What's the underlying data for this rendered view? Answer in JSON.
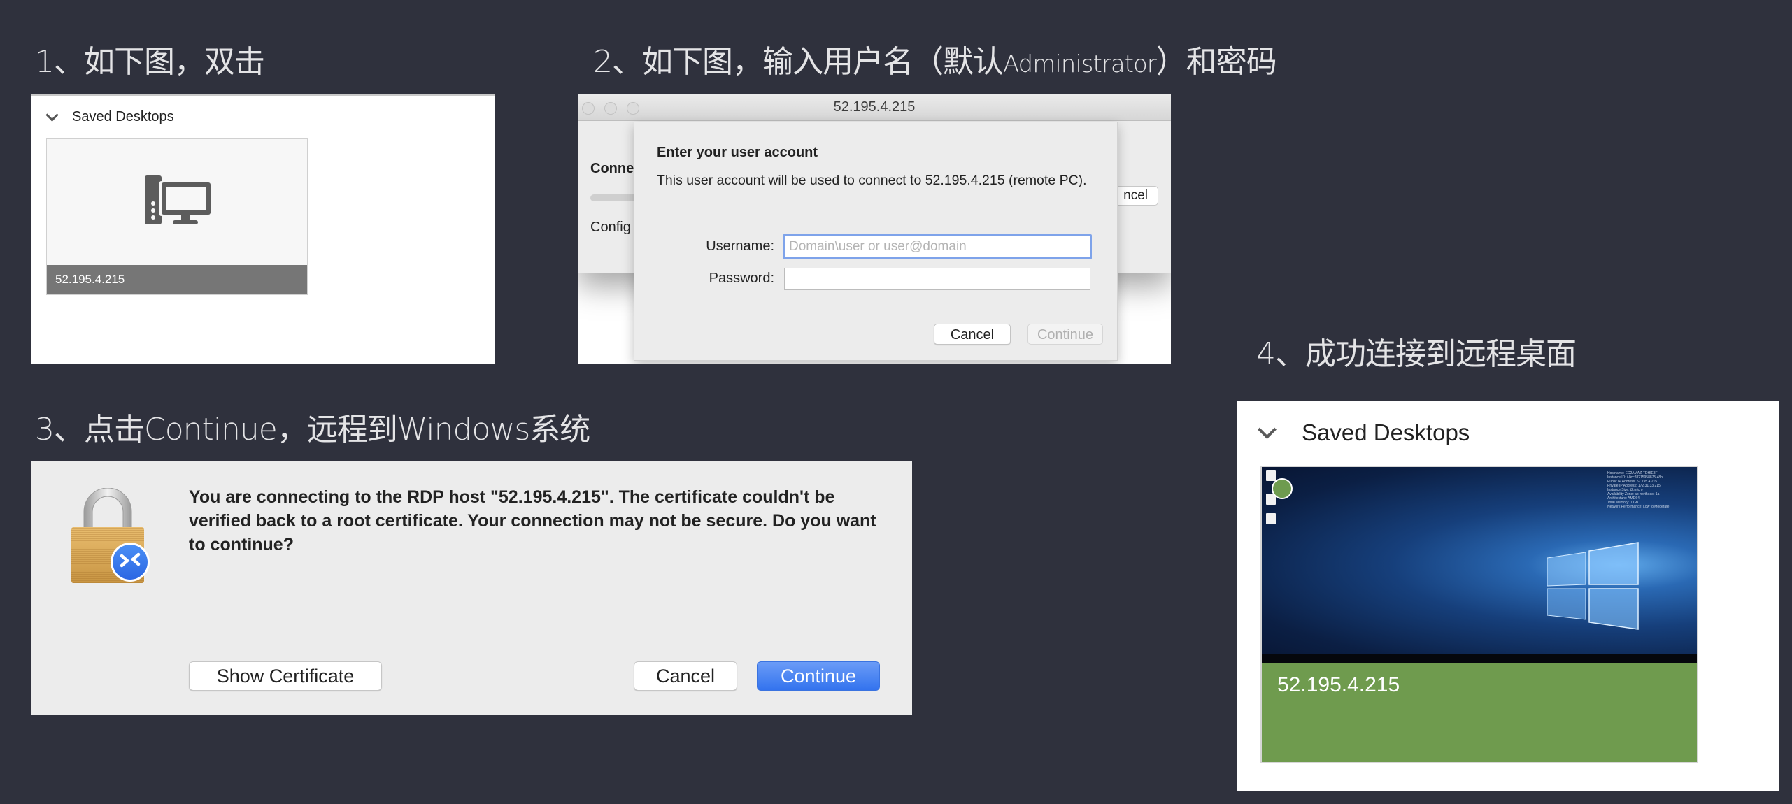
{
  "steps": [
    {
      "title": "1、如下图，双击"
    },
    {
      "title_pre": "2、如下图，输入用户名（默认",
      "title_small": "Administrator",
      "title_post": "）和密码"
    },
    {
      "title": "3、点击Continue，远程到Windows系统"
    },
    {
      "title": "4、成功连接到远程桌面"
    }
  ],
  "panel1": {
    "section_header": "Saved Desktops",
    "tile": {
      "label": "52.195.4.215",
      "icon": "computer-monitor-icon"
    }
  },
  "panel2": {
    "window_title": "52.195.4.215",
    "background": {
      "connecting_label": "Conne",
      "config_label": "Config",
      "cancel_label": "ncel"
    },
    "sheet": {
      "heading": "Enter your user account",
      "description": "This user account will be used to connect to 52.195.4.215 (remote PC).",
      "username_label": "Username:",
      "username_placeholder": "Domain\\user or user@domain",
      "username_value": "",
      "password_label": "Password:",
      "password_value": "",
      "cancel_button": "Cancel",
      "continue_button": "Continue"
    }
  },
  "panel3": {
    "message": "You are connecting to the RDP host \"52.195.4.215\". The certificate couldn't be verified back to a root certificate. Your connection may not be secure. Do you want to continue?",
    "show_certificate_button": "Show Certificate",
    "cancel_button": "Cancel",
    "continue_button": "Continue",
    "icon": "lock-remote-desktop-icon"
  },
  "panel4": {
    "section_header": "Saved Desktops",
    "tile": {
      "label": "52.195.4.215",
      "status": "connected",
      "status_color": "#6f9b4e",
      "sysinfo": [
        "Hostname: EC2AMAZ-TDHIE8F",
        "Instance ID: i-0cc28215958875 48b",
        "Public IP Address: 52.195.4.215",
        "Private IP Address: 172.31.33.215",
        "Instance Size: t2.micro",
        "Availability Zone: ap-northeast-1a",
        "Architecture: AMD64",
        "Total Memory: 1 GB",
        "Network Performance: Low to Moderate"
      ]
    }
  },
  "colors": {
    "background": "#2f313d",
    "accent_blue": "#3373ee",
    "connected_green": "#6f9b4e",
    "tile_footer_gray": "#767676"
  }
}
